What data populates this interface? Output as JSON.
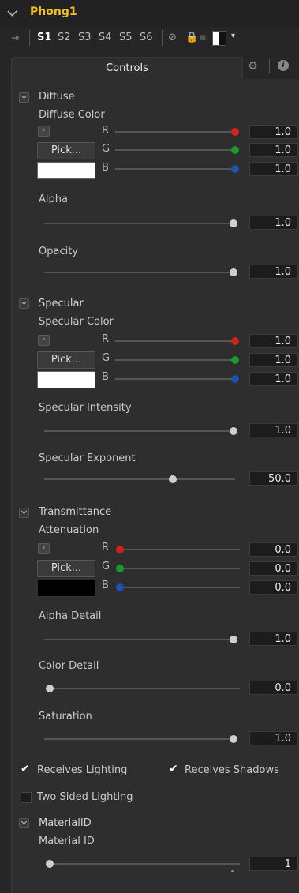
{
  "header": {
    "title": "Phong1"
  },
  "versions": [
    "S1",
    "S2",
    "S3",
    "S4",
    "S5",
    "S6"
  ],
  "tabs": {
    "controls": "Controls"
  },
  "diffuse": {
    "section": "Diffuse",
    "color_label": "Diffuse Color",
    "pick": "Pick...",
    "r": "1.0",
    "g": "1.0",
    "b": "1.0",
    "alpha_label": "Alpha",
    "alpha": "1.0",
    "opacity_label": "Opacity",
    "opacity": "1.0"
  },
  "specular": {
    "section": "Specular",
    "color_label": "Specular Color",
    "pick": "Pick...",
    "r": "1.0",
    "g": "1.0",
    "b": "1.0",
    "intensity_label": "Specular Intensity",
    "intensity": "1.0",
    "exponent_label": "Specular Exponent",
    "exponent": "50.0"
  },
  "transmittance": {
    "section": "Transmittance",
    "color_label": "Attenuation",
    "pick": "Pick...",
    "r": "0.0",
    "g": "0.0",
    "b": "0.0",
    "alpha_detail_label": "Alpha Detail",
    "alpha_detail": "1.0",
    "color_detail_label": "Color Detail",
    "color_detail": "0.0",
    "saturation_label": "Saturation",
    "saturation": "1.0"
  },
  "channel_labels": {
    "r": "R",
    "g": "G",
    "b": "B"
  },
  "options": {
    "receives_lighting": "Receives Lighting",
    "receives_shadows": "Receives Shadows",
    "two_sided": "Two Sided Lighting"
  },
  "material": {
    "section": "MaterialID",
    "label": "Material ID",
    "value": "1"
  },
  "colors": {
    "accent_title": "#f0c020",
    "knob_red": "#d42020",
    "knob_green": "#1a9a2a",
    "knob_blue": "#2050b0",
    "knob_gray": "#cfcfcf"
  }
}
